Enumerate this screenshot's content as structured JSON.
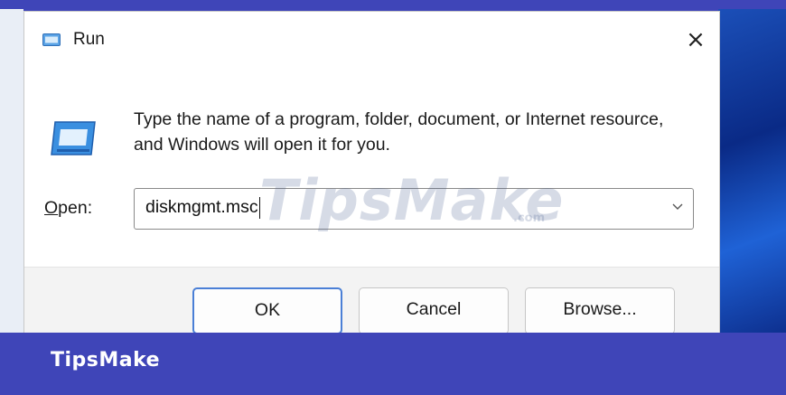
{
  "window": {
    "title": "Run",
    "close_icon": "×"
  },
  "content": {
    "description": "Type the name of a program, folder, document, or Internet resource, and Windows will open it for you.",
    "open_label_underlined": "O",
    "open_label_rest": "pen:",
    "open_value": "diskmgmt.msc"
  },
  "buttons": {
    "ok": "OK",
    "cancel": "Cancel",
    "browse": "Browse..."
  },
  "watermark": {
    "text": "TipsMake",
    "domain": ".com"
  },
  "banner": {
    "text": "TipsMake"
  },
  "colors": {
    "banner": "#3f45b8",
    "accent": "#4a7fd6"
  },
  "icons": [
    "run-app-icon",
    "close-icon",
    "run-large-icon",
    "chevron-down-icon"
  ]
}
